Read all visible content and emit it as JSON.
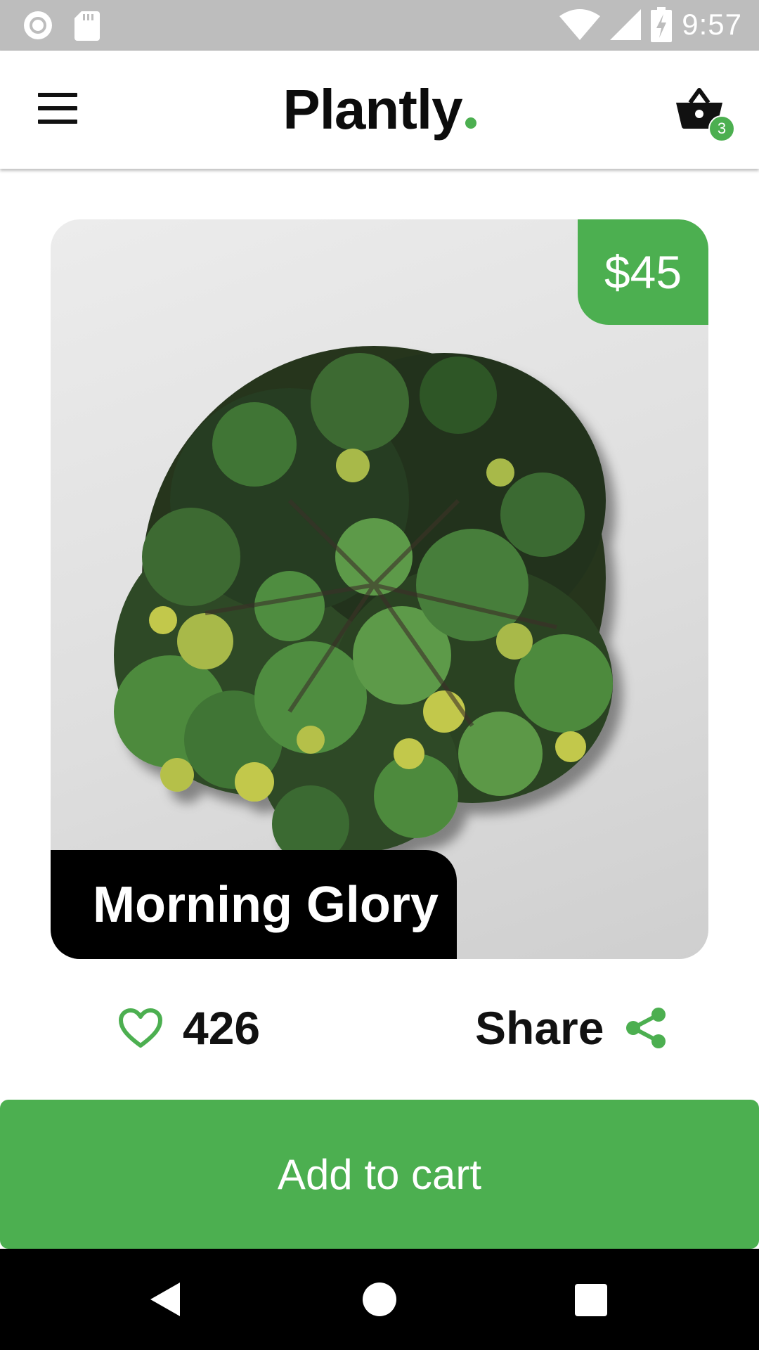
{
  "status_bar": {
    "time": "9:57",
    "icons": [
      "record-icon",
      "sd-card-icon",
      "wifi-icon",
      "signal-icon",
      "battery-charging-icon"
    ]
  },
  "app_bar": {
    "brand": "Plantly",
    "cart_count": "3",
    "icons": [
      "menu-icon",
      "basket-icon"
    ]
  },
  "product": {
    "name": "Morning Glory",
    "price": "$45",
    "likes": "426",
    "share_label": "Share"
  },
  "cta": {
    "label": "Add to cart"
  },
  "colors": {
    "accent": "#4caf50",
    "status_bar": "#bdbdbd",
    "text": "#111111",
    "name_tag": "#000000"
  },
  "nav": {
    "icons": [
      "back-icon",
      "home-icon",
      "recents-icon"
    ]
  }
}
